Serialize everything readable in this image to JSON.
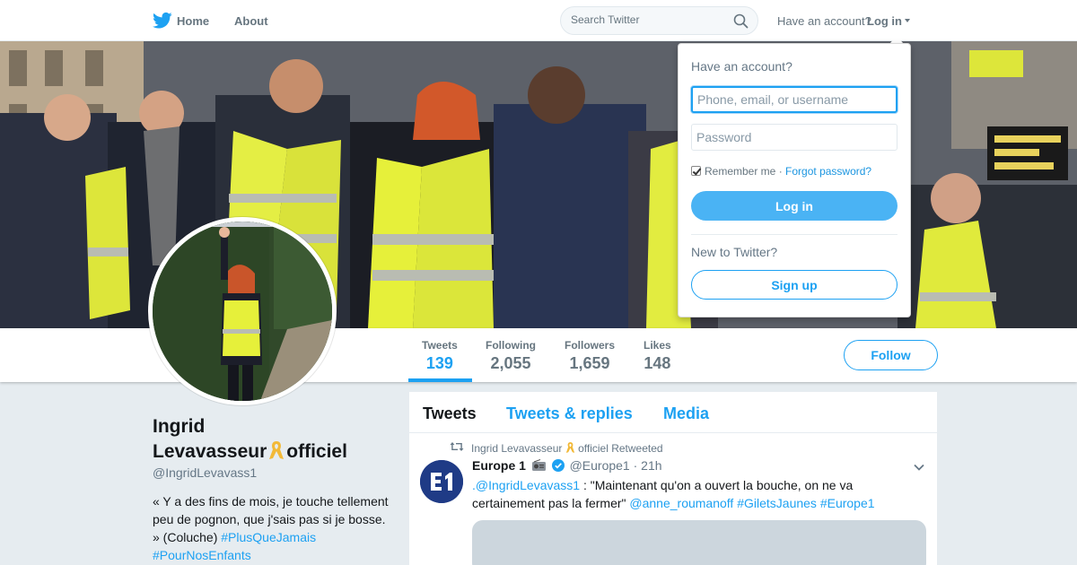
{
  "nav": {
    "home_label": "Home",
    "about_label": "About",
    "search_placeholder": "Search Twitter",
    "have_account_text": "Have an account?",
    "login_label": "Log in"
  },
  "login_dropdown": {
    "title": "Have an account?",
    "username_placeholder": "Phone, email, or username",
    "password_placeholder": "Password",
    "remember_label": "Remember me",
    "separator": "·",
    "forgot_label": "Forgot password?",
    "login_button": "Log in",
    "new_prompt": "New to Twitter?",
    "signup_button": "Sign up"
  },
  "profile_nav": {
    "stats": [
      {
        "label": "Tweets",
        "value": "139"
      },
      {
        "label": "Following",
        "value": "2,055"
      },
      {
        "label": "Followers",
        "value": "1,659"
      },
      {
        "label": "Likes",
        "value": "148"
      }
    ],
    "follow_label": "Follow"
  },
  "profile": {
    "name_line1": "Ingrid",
    "name_line2a": "Levavasseur",
    "name_line2b": "officiel",
    "handle": "@IngridLevavass1",
    "bio_text": "« Y a des fins de mois, je touche tellement peu de pognon, que j'sais pas si je bosse. » (Coluche)",
    "bio_tags": [
      "#PlusQueJamais",
      "#PourNosEnfants"
    ]
  },
  "timeline": {
    "tabs": [
      "Tweets",
      "Tweets & replies",
      "Media"
    ],
    "tweet": {
      "retweet_by_a": "Ingrid Levavasseur",
      "retweet_by_b": "officiel Retweeted",
      "author_name": "Europe 1",
      "author_handle": "@Europe1",
      "time": "· 21h",
      "mention": ".@IngridLevavass1",
      "text": " : \"Maintenant qu'on a ouvert la bouche, on ne va certainement pas la fermer\" ",
      "links": [
        "@anne_roumanoff",
        "#GiletsJaunes",
        "#Europe1"
      ]
    }
  },
  "colors": {
    "twitter_blue": "#1da1f2",
    "vest_yellow": "#e6f03a",
    "ribbon_gold": "#f2b938"
  },
  "icons": [
    "twitter-bird-icon",
    "search-icon",
    "caret-down-icon",
    "retweet-icon",
    "radio-icon",
    "verified-badge-icon",
    "yellow-ribbon-icon",
    "chevron-down-icon"
  ]
}
